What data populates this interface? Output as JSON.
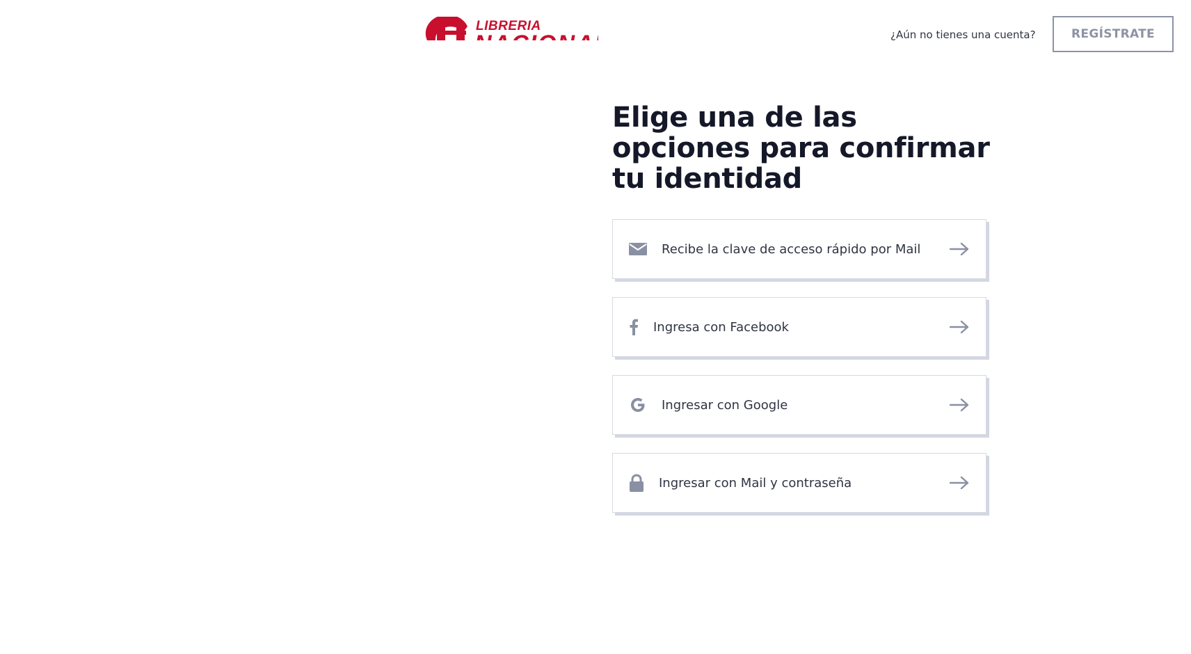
{
  "header": {
    "logo_text_top": "LIBRERIA",
    "logo_text_bottom": "NACIONAL",
    "prompt": "¿Aún no tienes una cuenta?",
    "register_label": "REGÍSTRATE"
  },
  "main": {
    "title": "Elige una de las opciones para confirmar tu identidad",
    "options": [
      {
        "label": "Recibe la clave de acceso rápido por Mail",
        "icon": "envelope-icon"
      },
      {
        "label": "Ingresa con Facebook",
        "icon": "facebook-icon"
      },
      {
        "label": "Ingresar con Google",
        "icon": "google-icon"
      },
      {
        "label": "Ingresar con Mail y contraseña",
        "icon": "lock-icon"
      }
    ]
  },
  "colors": {
    "brand_red": "#c8102e",
    "icon_gray": "#8a90a3",
    "title_dark": "#141828"
  }
}
